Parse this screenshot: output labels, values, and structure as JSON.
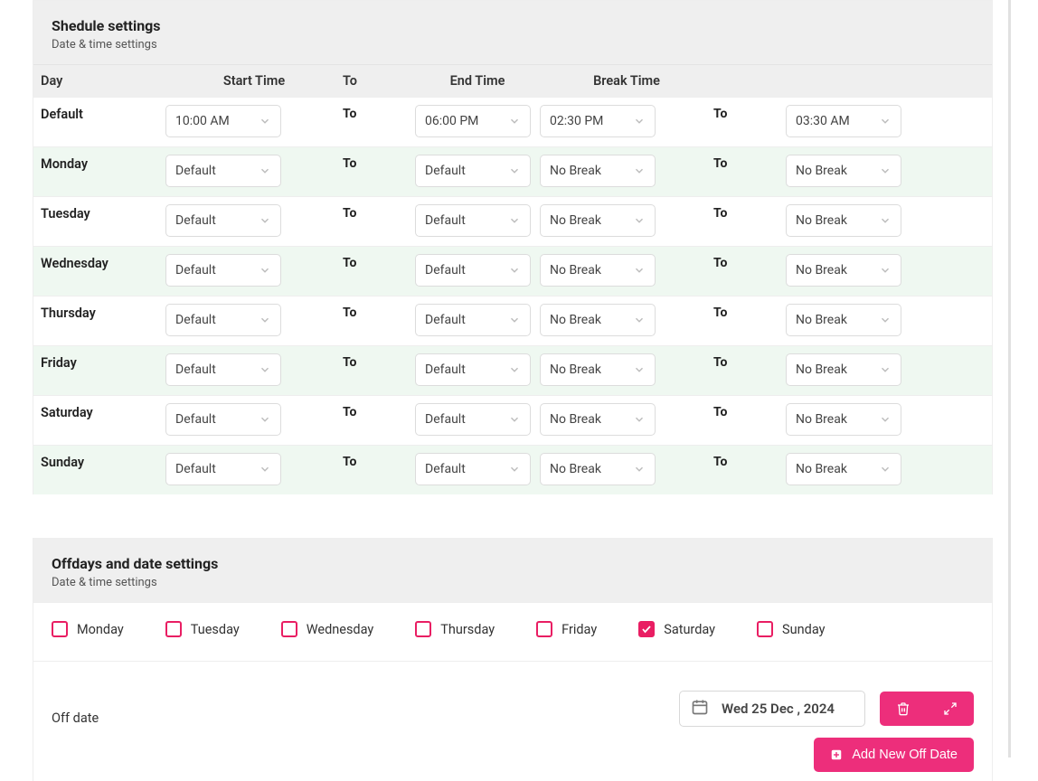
{
  "colors": {
    "accent": "#ed2e7b",
    "alt_row": "#eff8f1"
  },
  "schedule_panel": {
    "title": "Shedule settings",
    "subtitle": "Date & time settings",
    "columns": {
      "day": "Day",
      "start": "Start Time",
      "to": "To",
      "end": "End Time",
      "break": "Break Time"
    },
    "to_label": "To",
    "rows": [
      {
        "day": "Default",
        "start": "10:00 AM",
        "end": "06:00 PM",
        "break_start": "02:30 PM",
        "break_end": "03:30 AM",
        "alt": false
      },
      {
        "day": "Monday",
        "start": "Default",
        "end": "Default",
        "break_start": "No Break",
        "break_end": "No Break",
        "alt": true
      },
      {
        "day": "Tuesday",
        "start": "Default",
        "end": "Default",
        "break_start": "No Break",
        "break_end": "No Break",
        "alt": false
      },
      {
        "day": "Wednesday",
        "start": "Default",
        "end": "Default",
        "break_start": "No Break",
        "break_end": "No Break",
        "alt": true
      },
      {
        "day": "Thursday",
        "start": "Default",
        "end": "Default",
        "break_start": "No Break",
        "break_end": "No Break",
        "alt": false
      },
      {
        "day": "Friday",
        "start": "Default",
        "end": "Default",
        "break_start": "No Break",
        "break_end": "No Break",
        "alt": true
      },
      {
        "day": "Saturday",
        "start": "Default",
        "end": "Default",
        "break_start": "No Break",
        "break_end": "No Break",
        "alt": false
      },
      {
        "day": "Sunday",
        "start": "Default",
        "end": "Default",
        "break_start": "No Break",
        "break_end": "No Break",
        "alt": true
      }
    ]
  },
  "offdays_panel": {
    "title": "Offdays and date settings",
    "subtitle": "Date & time settings",
    "days": [
      {
        "label": "Monday",
        "checked": false
      },
      {
        "label": "Tuesday",
        "checked": false
      },
      {
        "label": "Wednesday",
        "checked": false
      },
      {
        "label": "Thursday",
        "checked": false
      },
      {
        "label": "Friday",
        "checked": false
      },
      {
        "label": "Saturday",
        "checked": true
      },
      {
        "label": "Sunday",
        "checked": false
      }
    ],
    "offdate_label": "Off date",
    "date_value": "Wed 25 Dec , 2024",
    "add_button_label": "Add New Off Date"
  }
}
